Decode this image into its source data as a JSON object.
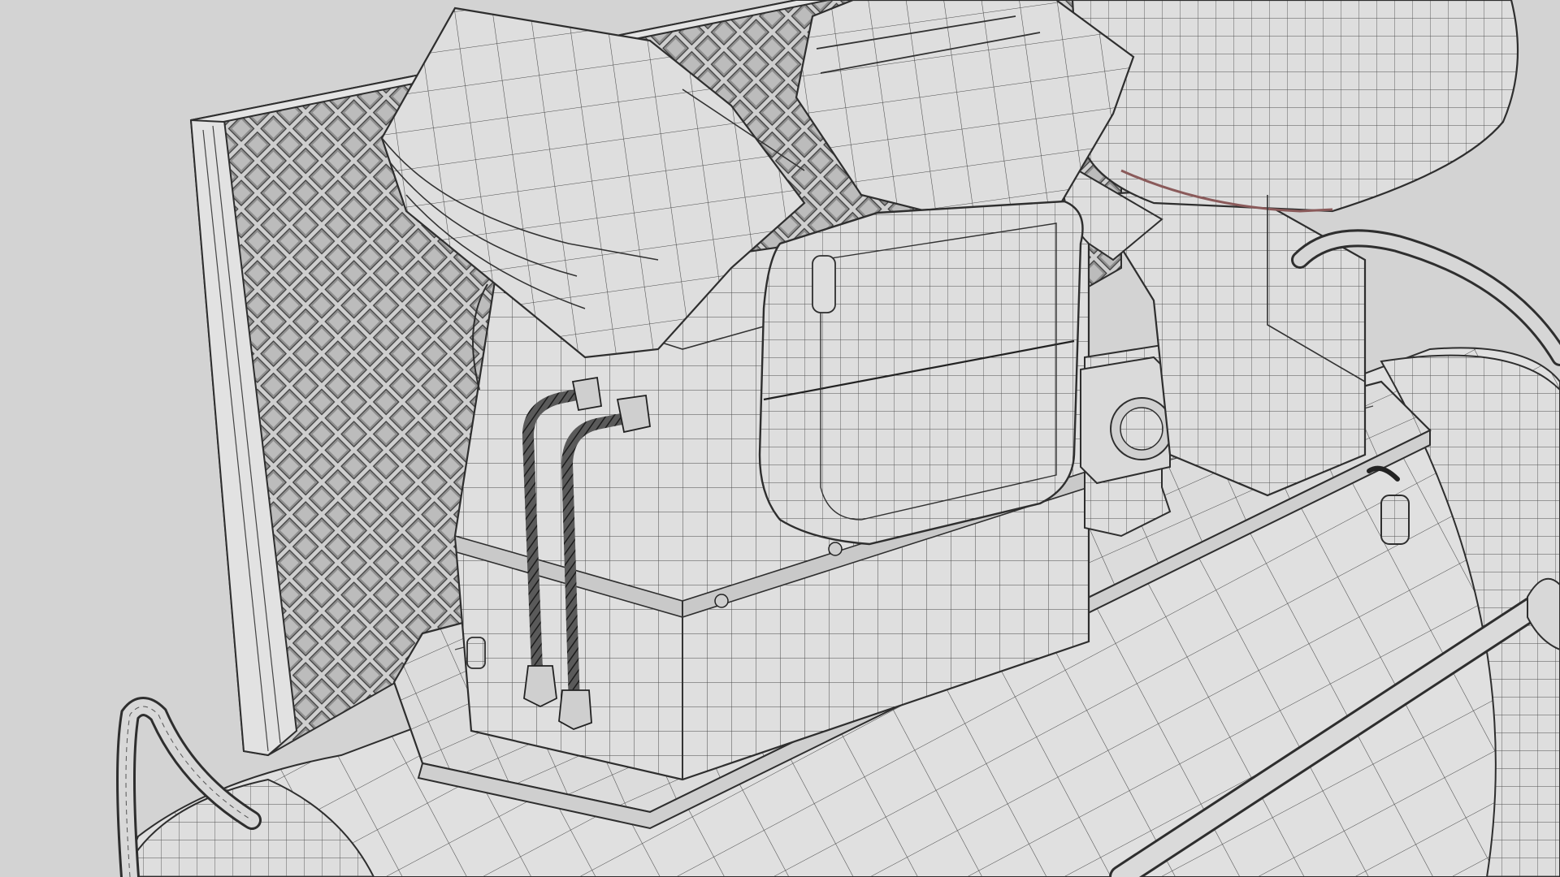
{
  "scene": {
    "subject": "air-compressor-wireframe",
    "background_color": "#d3d3d3",
    "surface_color": "#dcdcdc",
    "wire_color": "#3a3a3a",
    "accent_color": "#8a5a5a",
    "components": [
      "protective-grille-panel",
      "left-cylinder-head",
      "right-cylinder-head",
      "crankcase-block",
      "side-cover-plate",
      "electric-motor",
      "motor-bracket",
      "cable-box",
      "base-plate",
      "air-tank",
      "pressure-pipe-left",
      "pressure-pipe-right",
      "drain-valve",
      "power-cable",
      "carry-handle"
    ]
  }
}
